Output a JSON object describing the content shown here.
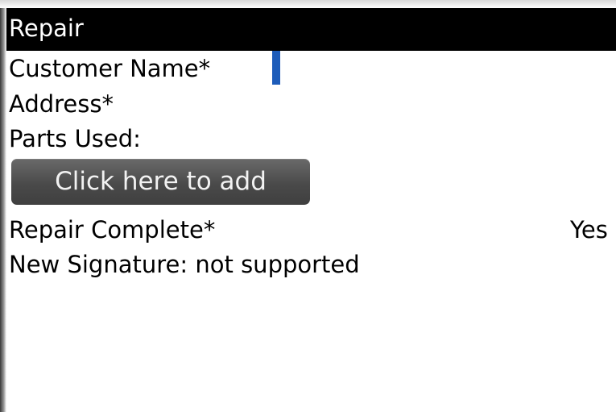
{
  "window": {
    "title": "Repair"
  },
  "form": {
    "customer_name_label": "Customer Name*",
    "customer_name_value": "",
    "address_label": "Address*",
    "parts_used_label": "Parts Used:",
    "add_parts_button_label": "Click here to add",
    "repair_complete_label": "Repair Complete*",
    "repair_complete_value": "Yes",
    "signature_label": "New Signature: not supported"
  },
  "colors": {
    "titlebar_background": "#000000",
    "titlebar_text": "#ffffff",
    "cursor": "#1d5cba",
    "button_background": "#4f4f4f",
    "button_text": "#f2f2f2"
  }
}
